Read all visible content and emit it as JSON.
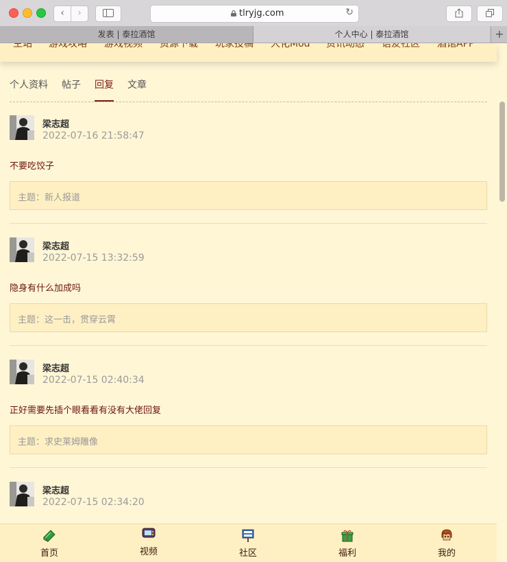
{
  "browser": {
    "url": "tlryjg.com",
    "tabs": [
      {
        "title": "发表 | 泰拉酒馆"
      },
      {
        "title": "个人中心 | 泰拉酒馆"
      }
    ],
    "new_tab": "+"
  },
  "site_nav": {
    "items": [
      "主站",
      "游戏攻略",
      "游戏视频",
      "资源下载",
      "玩家投稿",
      "大化Mod",
      "资讯动态",
      "语友社区",
      "酒馆APP"
    ]
  },
  "profile_tabs": {
    "items": [
      "个人资料",
      "帖子",
      "回复",
      "文章"
    ],
    "active": "回复"
  },
  "posts": [
    {
      "author": "梁志超",
      "time": "2022-07-16 21:58:47",
      "reply": "不要吃饺子",
      "topic": "主题：新人报道"
    },
    {
      "author": "梁志超",
      "time": "2022-07-15 13:32:59",
      "reply": "隐身有什么加成吗",
      "topic": "主题：这一击，贯穿云霄"
    },
    {
      "author": "梁志超",
      "time": "2022-07-15 02:40:34",
      "reply": "正好需要先插个眼看看有没有大佬回复",
      "topic": "主题：求史莱姆雕像"
    },
    {
      "author": "梁志超",
      "time": "2022-07-15 02:34:20"
    }
  ],
  "bottom_nav": {
    "items": [
      {
        "label": "首页",
        "icon": "book-icon"
      },
      {
        "label": "视频",
        "icon": "tv-icon"
      },
      {
        "label": "社区",
        "icon": "signboard-icon"
      },
      {
        "label": "福利",
        "icon": "gift-icon"
      },
      {
        "label": "我的",
        "icon": "character-icon"
      }
    ]
  },
  "colors": {
    "page_background": "#fff6d6",
    "accent": "#7b1d14",
    "topic_box": "#fff0c4"
  }
}
